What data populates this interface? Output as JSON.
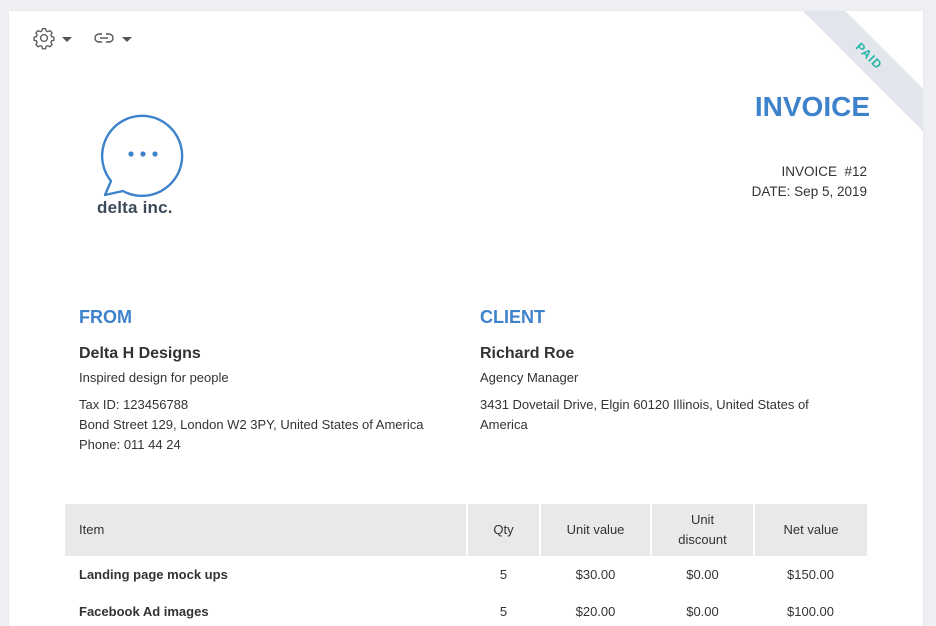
{
  "toolbar": {
    "settings_icon": "gear-icon",
    "link_icon": "link-icon"
  },
  "ribbon": {
    "label": "PAID",
    "color": "#1fb6a8"
  },
  "logo": {
    "company": "delta inc.",
    "accent": "#3e82cc"
  },
  "invoice": {
    "title": "INVOICE",
    "number": "INVOICE  #12",
    "date": "DATE: Sep 5, 2019"
  },
  "from": {
    "heading": "FROM",
    "name": "Delta H Designs",
    "tagline": "Inspired design for people",
    "tax_id": "Tax ID: 123456788",
    "address": "Bond Street 129, London W2 3PY, United States of America",
    "phone": "Phone: 011 44 24"
  },
  "client": {
    "heading": "CLIENT",
    "name": "Richard Roe",
    "title": "Agency Manager",
    "address": "3431 Dovetail Drive, Elgin 60120 Illinois, United States of America"
  },
  "table": {
    "headers": {
      "item": "Item",
      "qty": "Qty",
      "unit_value": "Unit value",
      "unit_discount_1": "Unit",
      "unit_discount_2": "discount",
      "net_value": "Net value"
    },
    "rows": [
      {
        "item": "Landing page mock ups",
        "qty": "5",
        "unit_value": "$30.00",
        "discount": "$0.00",
        "net": "$150.00"
      },
      {
        "item": "Facebook Ad images",
        "qty": "5",
        "unit_value": "$20.00",
        "discount": "$0.00",
        "net": "$100.00"
      }
    ]
  }
}
